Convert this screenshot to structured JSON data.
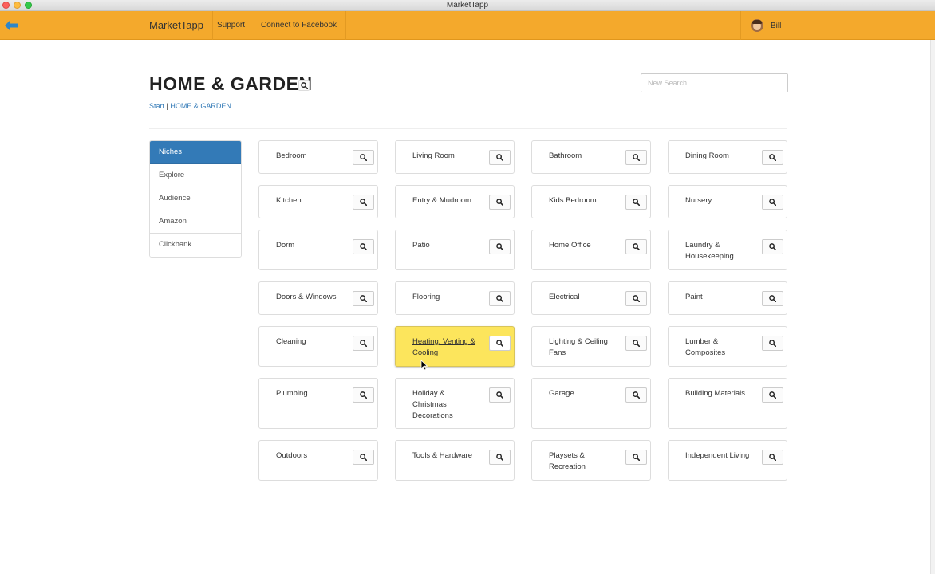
{
  "window": {
    "title": "MarketTapp"
  },
  "navbar": {
    "brand": "MarketTapp",
    "links": [
      "Support",
      "Connect to Facebook"
    ],
    "user": "Bill"
  },
  "header": {
    "title": "HOME & GARDEN",
    "breadcrumb": {
      "start": "Start",
      "separator": " | ",
      "current": "HOME & GARDEN"
    },
    "search_placeholder": "New Search"
  },
  "sidebar": {
    "items": [
      {
        "label": "Niches",
        "active": true
      },
      {
        "label": "Explore",
        "active": false
      },
      {
        "label": "Audience",
        "active": false
      },
      {
        "label": "Amazon",
        "active": false
      },
      {
        "label": "Clickbank",
        "active": false
      }
    ]
  },
  "niches": [
    [
      "Bedroom",
      "Living Room",
      "Bathroom",
      "Dining Room"
    ],
    [
      "Kitchen",
      "Entry & Mudroom",
      "Kids Bedroom",
      "Nursery"
    ],
    [
      "Dorm",
      "Patio",
      "Home Office",
      "Laundry & Housekeeping"
    ],
    [
      "Doors & Windows",
      "Flooring",
      "Electrical",
      "Paint"
    ],
    [
      "Cleaning",
      "Heating, Venting & Cooling",
      "Lighting & Ceiling Fans",
      "Lumber & Composites"
    ],
    [
      "Plumbing",
      "Holiday & Christmas Decorations",
      "Garage",
      "Building Materials"
    ],
    [
      "Outdoors",
      "Tools & Hardware",
      "Playsets & Recreation",
      "Independent Living"
    ]
  ],
  "highlighted_niche": "Heating, Venting & Cooling",
  "colors": {
    "navbar": "#f4a92c",
    "active": "#337ab7",
    "highlight": "#fce55c"
  },
  "icons": {
    "back": "back-arrow-icon",
    "search": "search-icon"
  }
}
